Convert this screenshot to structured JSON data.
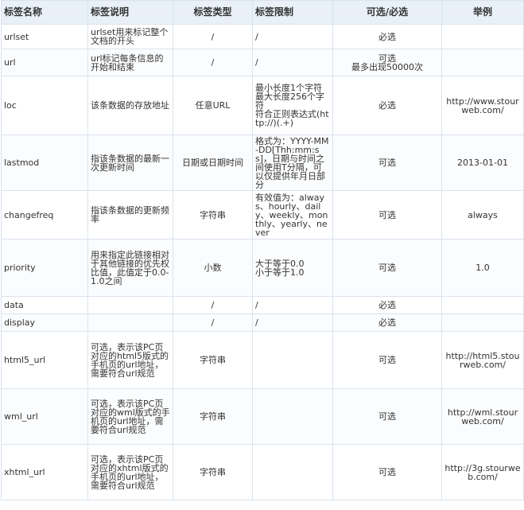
{
  "table": {
    "headers": [
      "标签名称",
      "标签说明",
      "标签类型",
      "标签限制",
      "可选/必选",
      "举例"
    ],
    "rows": [
      {
        "name": "urlset",
        "desc": "urlset用来标记整个文档的开头",
        "type": "/",
        "limit": "/",
        "req": "必选",
        "example": ""
      },
      {
        "name": "url",
        "desc": "url标记每条信息的开始和结束",
        "type": "/",
        "limit": "/",
        "req": "可选\n最多出现50000次",
        "example": ""
      },
      {
        "name": "loc",
        "desc": "该条数据的存放地址",
        "type": "任意URL",
        "limit": "最小长度1个字符\n最大长度256个字符\n符合正则表达式(http://)(.+)",
        "req": "必选",
        "example": "http://www.stourweb.com/"
      },
      {
        "name": "lastmod",
        "desc": "指该条数据的最新一次更新时间",
        "type": "日期或日期时间",
        "limit": "格式为：YYYY-MM-DD[Thh:mm:ss]，日期与时间之间使用T分隔，可以仅提供年月日部分",
        "req": "可选",
        "example": "2013-01-01"
      },
      {
        "name": "changefreq",
        "desc": "指该条数据的更新频率",
        "type": "字符串",
        "limit": "有效值为：always、hourly、daily、weekly、monthly、yearly、never",
        "req": "可选",
        "example": "always"
      },
      {
        "name": "priority",
        "desc": "用来指定此链接相对于其他链接的优先权比值，此值定于0.0-1.0之间",
        "type": "小数",
        "limit": "大于等于0.0\n小于等于1.0",
        "req": "可选",
        "example": "1.0"
      },
      {
        "name": "data",
        "desc": "",
        "type": "/",
        "limit": "/",
        "req": "必选",
        "example": ""
      },
      {
        "name": "display",
        "desc": "",
        "type": "/",
        "limit": "/",
        "req": "必选",
        "example": ""
      },
      {
        "name": "html5_url",
        "desc": "可选，表示该PC页对应的html5版式的手机页的url地址，需要符合url规范",
        "type": "字符串",
        "limit": "",
        "req": "可选",
        "example": "http://html5.stourweb.com/"
      },
      {
        "name": "wml_url",
        "desc": "可选，表示该PC页对应的wml版式的手机页的url地址，需要符合url规范",
        "type": "字符串",
        "limit": "",
        "req": "可选",
        "example": "http://wml.stourweb.com/"
      },
      {
        "name": "xhtml_url",
        "desc": "可选，表示该PC页对应的xhtml版式的手机页的url地址，需要符合url规范",
        "type": "字符串",
        "limit": "",
        "req": "可选",
        "example": "http://3g.stourweb.com/"
      }
    ]
  }
}
